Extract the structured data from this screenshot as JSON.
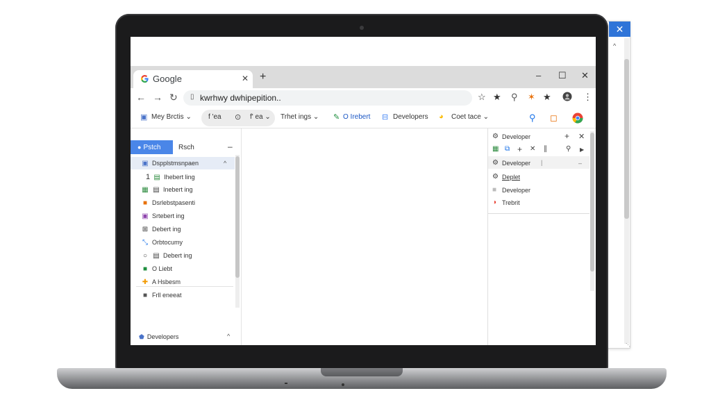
{
  "background_window": {
    "close_label": "✕"
  },
  "browser": {
    "tab": {
      "title": "Google",
      "close": "✕"
    },
    "new_tab": "+",
    "window_controls": {
      "minimize": "–",
      "maximize": "☐",
      "close": "✕"
    },
    "nav": {
      "back": "←",
      "forward": "→",
      "reload": "↻"
    },
    "address_bar": {
      "value": "kwrhwy dwhipepition.."
    },
    "colors": {
      "accent": "#4a86e8",
      "brand_blue": "#4285f4",
      "titlebar": "#dcdcdc"
    }
  },
  "bookmarks": [
    {
      "label": "Mey Brctis",
      "icon": "bookmark-icon"
    },
    {
      "label": "f 'ea",
      "icon": "f-icon"
    },
    {
      "label": "",
      "icon": "circle-icon"
    },
    {
      "label": "f' ea",
      "icon": "f-icon"
    },
    {
      "label": "Trhet ings",
      "icon": ""
    },
    {
      "label": "O Irebert",
      "icon": "edit-icon"
    },
    {
      "label": "Developers",
      "icon": "developers-icon"
    },
    {
      "label": "Coet tace",
      "icon": "google-icon"
    }
  ],
  "left_panel": {
    "button_label": "Pstch",
    "side_label": "Rsch",
    "collapse": "–",
    "items": [
      {
        "label": "Dspplstmsnpaen",
        "icon": "group-icon",
        "color": "#4a73c9"
      },
      {
        "label": "Ihebert ling",
        "icon": "sheet-icon",
        "color": "#2b8a3e",
        "prefix": "1"
      },
      {
        "label": "Inebert ing",
        "icon": "grid-icon",
        "color": "#2b8a3e"
      },
      {
        "label": "Dsrlebstpasenti",
        "icon": "square-icon",
        "color": "#e8710a"
      },
      {
        "label": "Srtebert ing",
        "icon": "square-icon",
        "color": "#8e44ad"
      },
      {
        "label": "Debert ing",
        "icon": "group-icon",
        "color": "#333333"
      },
      {
        "label": "Orbtocumy",
        "icon": "connect-icon",
        "color": "#1a73e8"
      },
      {
        "label": "Debert ing",
        "icon": "circle-icon",
        "color": "#444444"
      },
      {
        "label": "O Liebt",
        "icon": "square-icon",
        "color": "#1e8e3e"
      },
      {
        "label": "A Hsbesm",
        "icon": "puzzle-icon",
        "color": "#f29900"
      },
      {
        "label": "Frll eneeat",
        "icon": "square-icon",
        "color": "#555555"
      }
    ],
    "footer": "Developers"
  },
  "right_panel": {
    "title": "Developer",
    "toolbar_icons": [
      "grid-icon",
      "select-icon",
      "plus-icon",
      "cross-icon",
      "edit-icon",
      "search-icon",
      "play-icon"
    ],
    "sub_title": "Developer",
    "items": [
      {
        "label": "Deplet",
        "icon": "gear-icon"
      },
      {
        "label": "Developer",
        "icon": "square-icon"
      },
      {
        "label": "Trebrit",
        "icon": "google-icon"
      }
    ]
  }
}
